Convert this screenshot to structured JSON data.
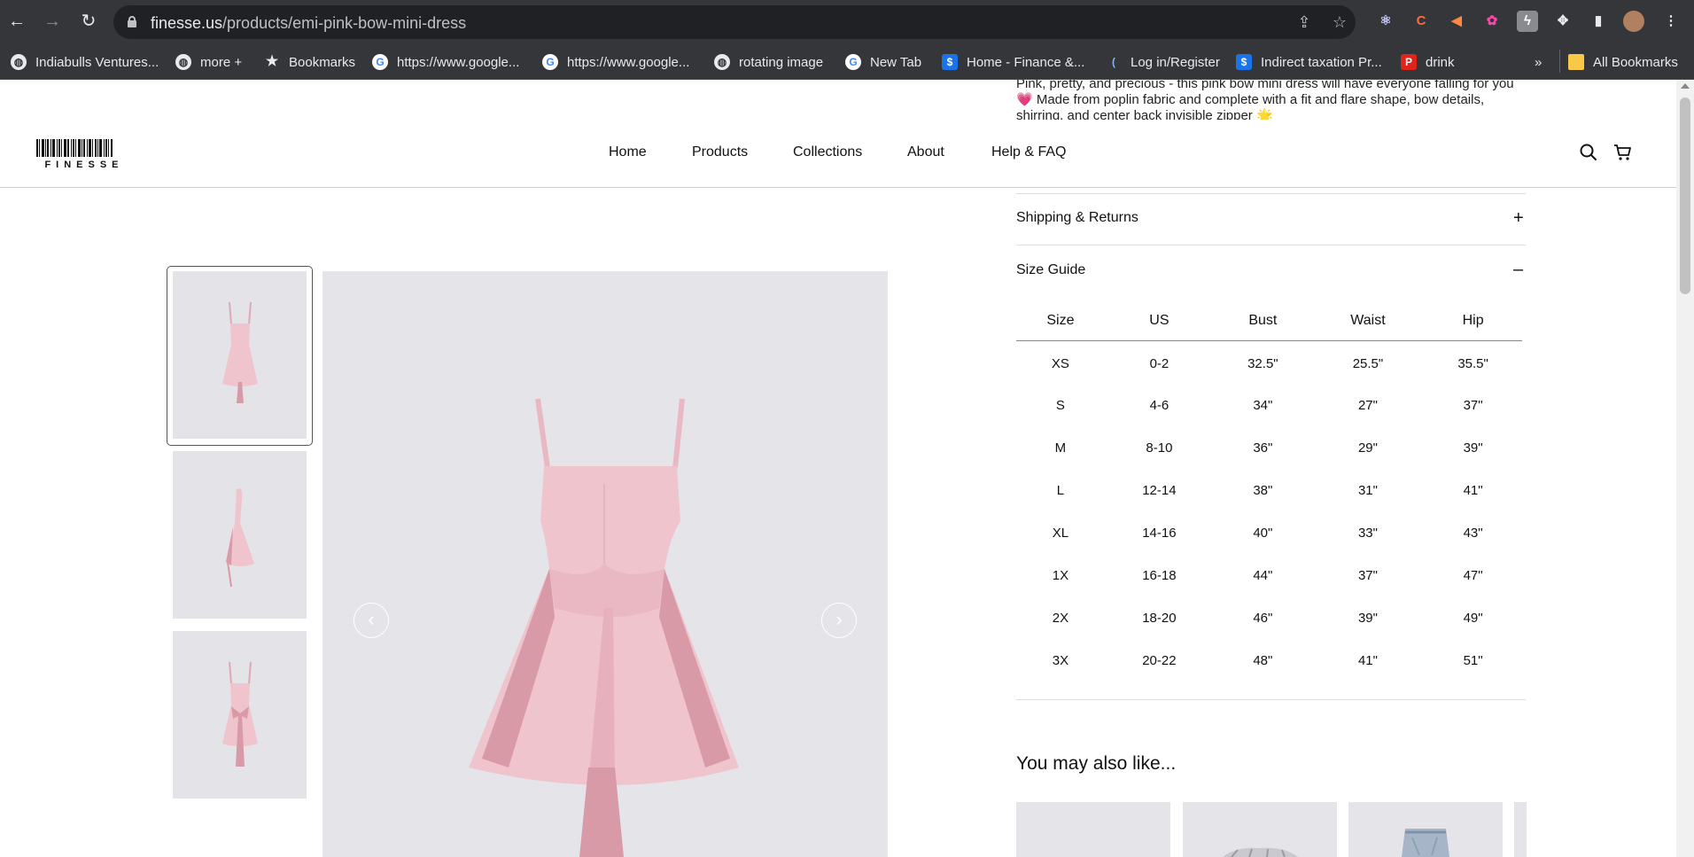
{
  "browser": {
    "url_host": "finesse.us",
    "url_path": "/products/emi-pink-bow-mini-dress",
    "bookmarks": [
      {
        "label": "Indiabulls Ventures...",
        "icon": "globe-icon"
      },
      {
        "label": "more +",
        "icon": "globe-icon"
      },
      {
        "label": "Bookmarks",
        "icon": "star-icon"
      },
      {
        "label": "https://www.google...",
        "icon": "google-icon"
      },
      {
        "label": "https://www.google...",
        "icon": "google-icon"
      },
      {
        "label": "rotating image",
        "icon": "globe-icon"
      },
      {
        "label": "New Tab",
        "icon": "google-icon"
      },
      {
        "label": "Home - Finance &...",
        "icon": "dollar-icon"
      },
      {
        "label": "Log in/Register",
        "icon": "bracket-icon"
      },
      {
        "label": "Indirect taxation Pr...",
        "icon": "dollar-icon"
      },
      {
        "label": "drink",
        "icon": "p-icon"
      }
    ],
    "overflow": "»",
    "all_bookmarks": "All Bookmarks"
  },
  "site": {
    "logo_text": "FINESSE",
    "nav": [
      "Home",
      "Products",
      "Collections",
      "About",
      "Help & FAQ"
    ]
  },
  "product": {
    "description": "Pink, pretty, and precious - this pink bow mini dress will have everyone falling for you 💗 Made from poplin fabric and complete with a fit and flare shape, bow details, shirring, and center back invisible zipper 🌟",
    "shipping_label": "Shipping & Returns",
    "shipping_sign": "+",
    "size_guide_label": "Size Guide",
    "size_guide_sign": "–",
    "size_table": {
      "headers": [
        "Size",
        "US",
        "Bust",
        "Waist",
        "Hip"
      ],
      "rows": [
        [
          "XS",
          "0-2",
          "32.5\"",
          "25.5\"",
          "35.5\""
        ],
        [
          "S",
          "4-6",
          "34\"",
          "27\"",
          "37\""
        ],
        [
          "M",
          "8-10",
          "36\"",
          "29\"",
          "39\""
        ],
        [
          "L",
          "12-14",
          "38\"",
          "31\"",
          "41\""
        ],
        [
          "XL",
          "14-16",
          "40\"",
          "33\"",
          "43\""
        ],
        [
          "1X",
          "16-18",
          "44\"",
          "37\"",
          "47\""
        ],
        [
          "2X",
          "18-20",
          "46\"",
          "39\"",
          "49\""
        ],
        [
          "3X",
          "20-22",
          "48\"",
          "41\"",
          "51\""
        ]
      ]
    },
    "also_like_title": "You may also like..."
  },
  "colors": {
    "dress_pink": "#f0c4cc",
    "dress_shadow": "#d99aa8",
    "image_bg": "#e4e4e9",
    "chrome_bg": "#35363a"
  }
}
